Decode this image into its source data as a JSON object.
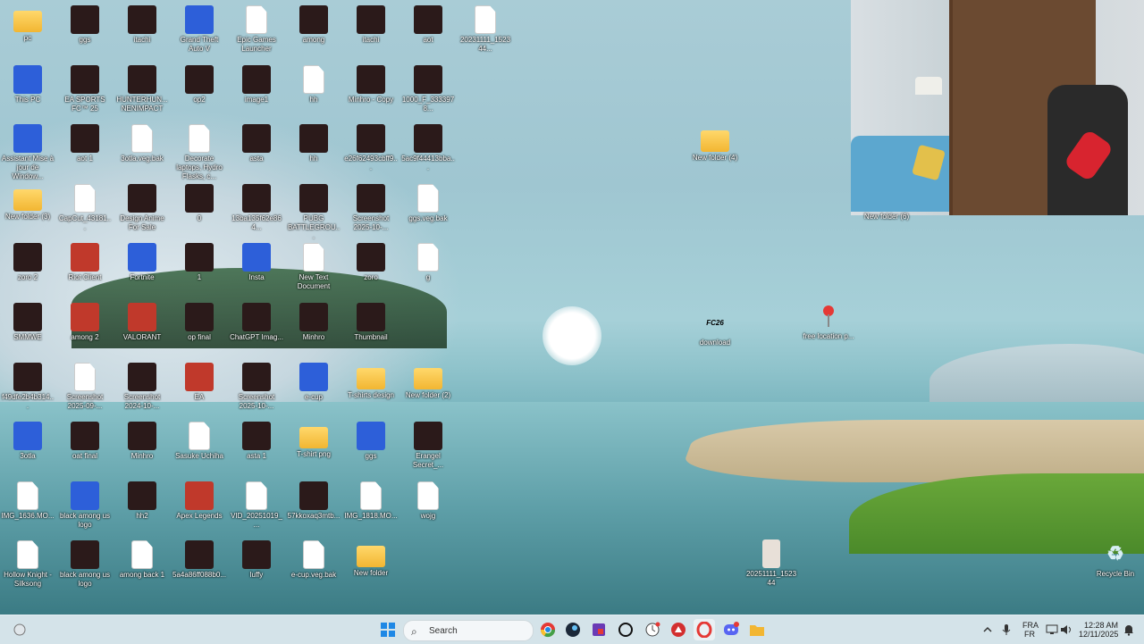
{
  "desktop_icons": [
    {
      "label": "pc",
      "type": "folder",
      "row": 0,
      "col": 0
    },
    {
      "label": "ggs",
      "type": "dark",
      "row": 0,
      "col": 1
    },
    {
      "label": "itachi",
      "type": "dark",
      "row": 0,
      "col": 2
    },
    {
      "label": "Grand Theft Auto V",
      "type": "blue",
      "row": 0,
      "col": 3
    },
    {
      "label": "Epic Games Launcher",
      "type": "doc",
      "row": 0,
      "col": 4
    },
    {
      "label": "among",
      "type": "dark",
      "row": 0,
      "col": 5
    },
    {
      "label": "itachi",
      "type": "dark",
      "row": 0,
      "col": 6
    },
    {
      "label": "aot",
      "type": "dark",
      "row": 0,
      "col": 7
    },
    {
      "label": "20231111_152344...",
      "type": "doc",
      "row": 0,
      "col": 8
    },
    {
      "label": "This PC",
      "type": "blue",
      "row": 1,
      "col": 0
    },
    {
      "label": "EA SPORTS FC™ 25",
      "type": "dark",
      "row": 1,
      "col": 1
    },
    {
      "label": "HUNTERHUN... NENIMPACT",
      "type": "dark",
      "row": 1,
      "col": 2
    },
    {
      "label": "op2",
      "type": "dark",
      "row": 1,
      "col": 3
    },
    {
      "label": "image1",
      "type": "dark",
      "row": 1,
      "col": 4
    },
    {
      "label": "hh",
      "type": "doc",
      "row": 1,
      "col": 5
    },
    {
      "label": "Minhro - Copy",
      "type": "dark",
      "row": 1,
      "col": 6
    },
    {
      "label": "1000_F_3333978...",
      "type": "dark",
      "row": 1,
      "col": 7
    },
    {
      "label": "Assistant Mise à jour de Window...",
      "type": "blue",
      "row": 2,
      "col": 0
    },
    {
      "label": "aot 1",
      "type": "dark",
      "row": 2,
      "col": 1
    },
    {
      "label": "3otla.veg.bak",
      "type": "doc",
      "row": 2,
      "col": 2
    },
    {
      "label": "Decorate laptops, Hydro Flasks, c...",
      "type": "doc",
      "row": 2,
      "col": 3
    },
    {
      "label": "asta",
      "type": "dark",
      "row": 2,
      "col": 4
    },
    {
      "label": "hh",
      "type": "dark",
      "row": 2,
      "col": 5
    },
    {
      "label": "e26f62493cbff9...",
      "type": "dark",
      "row": 2,
      "col": 6
    },
    {
      "label": "5ac9f44413bba...",
      "type": "dark",
      "row": 2,
      "col": 7
    },
    {
      "label": "New folder (3)",
      "type": "folder",
      "row": 3,
      "col": 0
    },
    {
      "label": "CapCut_43181...",
      "type": "doc",
      "row": 3,
      "col": 1
    },
    {
      "label": "Design Anime For Sale",
      "type": "dark",
      "row": 3,
      "col": 2
    },
    {
      "label": "0",
      "type": "dark",
      "row": 3,
      "col": 3
    },
    {
      "label": "13ba135f62e864...",
      "type": "dark",
      "row": 3,
      "col": 4
    },
    {
      "label": "PUBG BATTLEGROU...",
      "type": "dark",
      "row": 3,
      "col": 5
    },
    {
      "label": "Screenshot 2025-10-...",
      "type": "dark",
      "row": 3,
      "col": 6
    },
    {
      "label": "ggs.veg.bak",
      "type": "doc",
      "row": 3,
      "col": 7
    },
    {
      "label": "zoro 2",
      "type": "dark",
      "row": 4,
      "col": 0
    },
    {
      "label": "Riot Client",
      "type": "red",
      "row": 4,
      "col": 1
    },
    {
      "label": "Fortnite",
      "type": "blue",
      "row": 4,
      "col": 2
    },
    {
      "label": "1",
      "type": "dark",
      "row": 4,
      "col": 3
    },
    {
      "label": "Insta",
      "type": "blue",
      "row": 4,
      "col": 4
    },
    {
      "label": "New Text Document",
      "type": "doc",
      "row": 4,
      "col": 5
    },
    {
      "label": "zoro",
      "type": "dark",
      "row": 4,
      "col": 6
    },
    {
      "label": "g",
      "type": "doc",
      "row": 4,
      "col": 7
    },
    {
      "label": "SMMWE",
      "type": "dark",
      "row": 5,
      "col": 0
    },
    {
      "label": "among 2",
      "type": "red",
      "row": 5,
      "col": 1
    },
    {
      "label": "VALORANT",
      "type": "red",
      "row": 5,
      "col": 2
    },
    {
      "label": "op final",
      "type": "dark",
      "row": 5,
      "col": 3
    },
    {
      "label": "ChatGPT Imag...",
      "type": "dark",
      "row": 5,
      "col": 4
    },
    {
      "label": "Minhro",
      "type": "dark",
      "row": 5,
      "col": 5
    },
    {
      "label": "Thumbnail",
      "type": "dark",
      "row": 5,
      "col": 6
    },
    {
      "label": "f49dfe2b4b314...",
      "type": "dark",
      "row": 6,
      "col": 0
    },
    {
      "label": "Screenshot 2025-09-...",
      "type": "doc",
      "row": 6,
      "col": 1
    },
    {
      "label": "Screenshot 2024-10-...",
      "type": "dark",
      "row": 6,
      "col": 2
    },
    {
      "label": "EA",
      "type": "red",
      "row": 6,
      "col": 3
    },
    {
      "label": "Screenshot 2025-10-...",
      "type": "dark",
      "row": 6,
      "col": 4
    },
    {
      "label": "e-cup",
      "type": "blue",
      "row": 6,
      "col": 5
    },
    {
      "label": "T-shirts design",
      "type": "folder",
      "row": 6,
      "col": 6
    },
    {
      "label": "New folder (2)",
      "type": "folder",
      "row": 6,
      "col": 7
    },
    {
      "label": "3otla",
      "type": "blue",
      "row": 7,
      "col": 0
    },
    {
      "label": "oat final",
      "type": "dark",
      "row": 7,
      "col": 1
    },
    {
      "label": "Minhro",
      "type": "dark",
      "row": 7,
      "col": 2
    },
    {
      "label": "Sasuke Uchiha",
      "type": "doc",
      "row": 7,
      "col": 3
    },
    {
      "label": "asta 1",
      "type": "dark",
      "row": 7,
      "col": 4
    },
    {
      "label": "T-shirt png",
      "type": "folder",
      "row": 7,
      "col": 5
    },
    {
      "label": "ggs",
      "type": "blue",
      "row": 7,
      "col": 6
    },
    {
      "label": "Erangel Secret_...",
      "type": "dark",
      "row": 7,
      "col": 7
    },
    {
      "label": "IMG_1636.MO...",
      "type": "doc",
      "row": 8,
      "col": 0
    },
    {
      "label": "black among us logo",
      "type": "blue",
      "row": 8,
      "col": 1
    },
    {
      "label": "hh2",
      "type": "dark",
      "row": 8,
      "col": 2
    },
    {
      "label": "Apex Legends",
      "type": "red",
      "row": 8,
      "col": 3
    },
    {
      "label": "VID_20251019_...",
      "type": "doc",
      "row": 8,
      "col": 4
    },
    {
      "label": "57kkoxaq3mtb...",
      "type": "dark",
      "row": 8,
      "col": 5
    },
    {
      "label": "IMG_1818.MO...",
      "type": "doc",
      "row": 8,
      "col": 6
    },
    {
      "label": "wojg",
      "type": "doc",
      "row": 8,
      "col": 7
    },
    {
      "label": "Hollow Knight - Silksong",
      "type": "doc",
      "row": 9,
      "col": 0
    },
    {
      "label": "black among us logo",
      "type": "dark",
      "row": 9,
      "col": 1
    },
    {
      "label": "among back 1",
      "type": "doc",
      "row": 9,
      "col": 2
    },
    {
      "label": "5a4a86ff088b0...",
      "type": "dark",
      "row": 9,
      "col": 3
    },
    {
      "label": "luffy",
      "type": "dark",
      "row": 9,
      "col": 4
    },
    {
      "label": "e-cup.veg.bak",
      "type": "doc",
      "row": 9,
      "col": 5
    },
    {
      "label": "New folder",
      "type": "folder",
      "row": 9,
      "col": 6
    }
  ],
  "free_icons": {
    "new_folder_4": "New folder (4)",
    "new_folder_6": "New folder (6)",
    "download": "download",
    "free_location": "free location p...",
    "photo_20251111": "20251111_152344",
    "recycle_bin": "Recycle Bin",
    "fc26_text": "FC26"
  },
  "taskbar": {
    "search_placeholder": "Search",
    "lang_top": "FRA",
    "lang_bottom": "FR",
    "time": "12:28 AM",
    "date": "12/11/2025"
  },
  "colors": {
    "taskbar_bg": "#d2e1e8",
    "folder": "#f2b632",
    "accent_blue": "#2d5fd9"
  }
}
